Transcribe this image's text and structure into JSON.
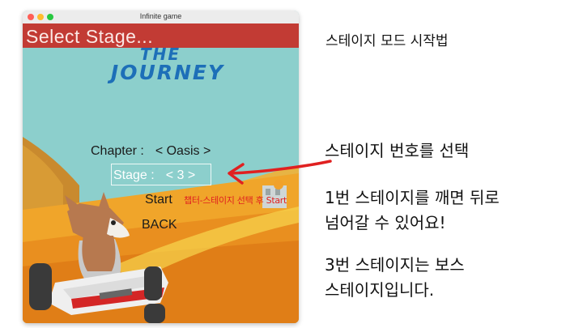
{
  "window": {
    "title": "Infinite game"
  },
  "game": {
    "banner_title": "Select Stage...",
    "logo_line1": "THE",
    "logo_line2": "JOURNEY",
    "chapter_label": "Chapter :",
    "chapter_value": "< Oasis >",
    "stage_label": "Stage :",
    "stage_value": "< 3 >",
    "start_label": "Start",
    "back_label": "BACK",
    "tip_text": "챕터-스테이지 선택 후 Start"
  },
  "annotations": {
    "heading": "스테이지 모드 시작법",
    "select_stage": "스테이지 번호를 선택",
    "clear_line1": "1번 스테이지를 깨면 뒤로",
    "clear_line2": "넘어갈 수 있어요!",
    "boss_line1": "3번 스테이지는 보스",
    "boss_line2": "스테이지입니다."
  },
  "colors": {
    "banner": "#c23b34",
    "sky": "#8ccfcc",
    "logo": "#1d6fb8",
    "tip_red": "#e02020",
    "arrow_red": "#e02020"
  }
}
